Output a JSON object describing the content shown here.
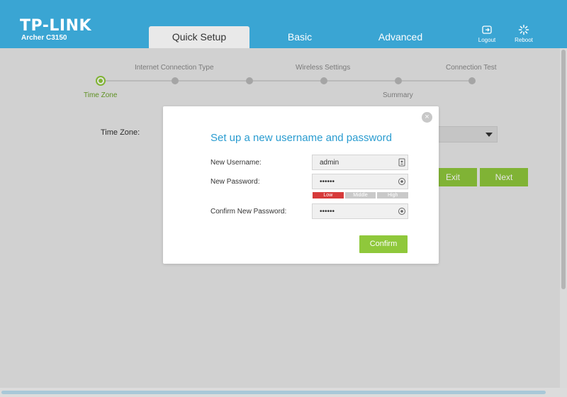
{
  "header": {
    "logo": "TP-LINK",
    "model": "Archer C3150",
    "tabs": [
      {
        "label": "Quick Setup",
        "active": true
      },
      {
        "label": "Basic",
        "active": false
      },
      {
        "label": "Advanced",
        "active": false
      }
    ],
    "logout_label": "Logout",
    "reboot_label": "Reboot",
    "color": "#3aa5d3"
  },
  "stepper": {
    "steps": [
      {
        "label": "Time Zone",
        "active": true
      },
      {
        "label": "Internet Connection Type",
        "active": false
      },
      {
        "label": "",
        "active": false
      },
      {
        "label": "Wireless Settings",
        "active": false
      },
      {
        "label": "Summary",
        "active": false
      },
      {
        "label": "Connection Test",
        "active": false
      }
    ]
  },
  "background_form": {
    "time_zone_label": "Time Zone:",
    "exit_label": "Exit",
    "next_label": "Next"
  },
  "dialog": {
    "title": "Set up a new username and password",
    "username_label": "New Username:",
    "username_value": "admin",
    "password_label": "New Password:",
    "password_value": "••••••",
    "strength": {
      "low": "Low",
      "middle": "Middle",
      "high": "High",
      "level": "Low"
    },
    "confirm_password_label": "Confirm New Password:",
    "confirm_password_value": "••••••",
    "confirm_label": "Confirm",
    "close_symbol": "×"
  },
  "colors": {
    "accent": "#2a9cd0",
    "button_green": "#8fc83b",
    "low_strength": "#d63a3a"
  }
}
